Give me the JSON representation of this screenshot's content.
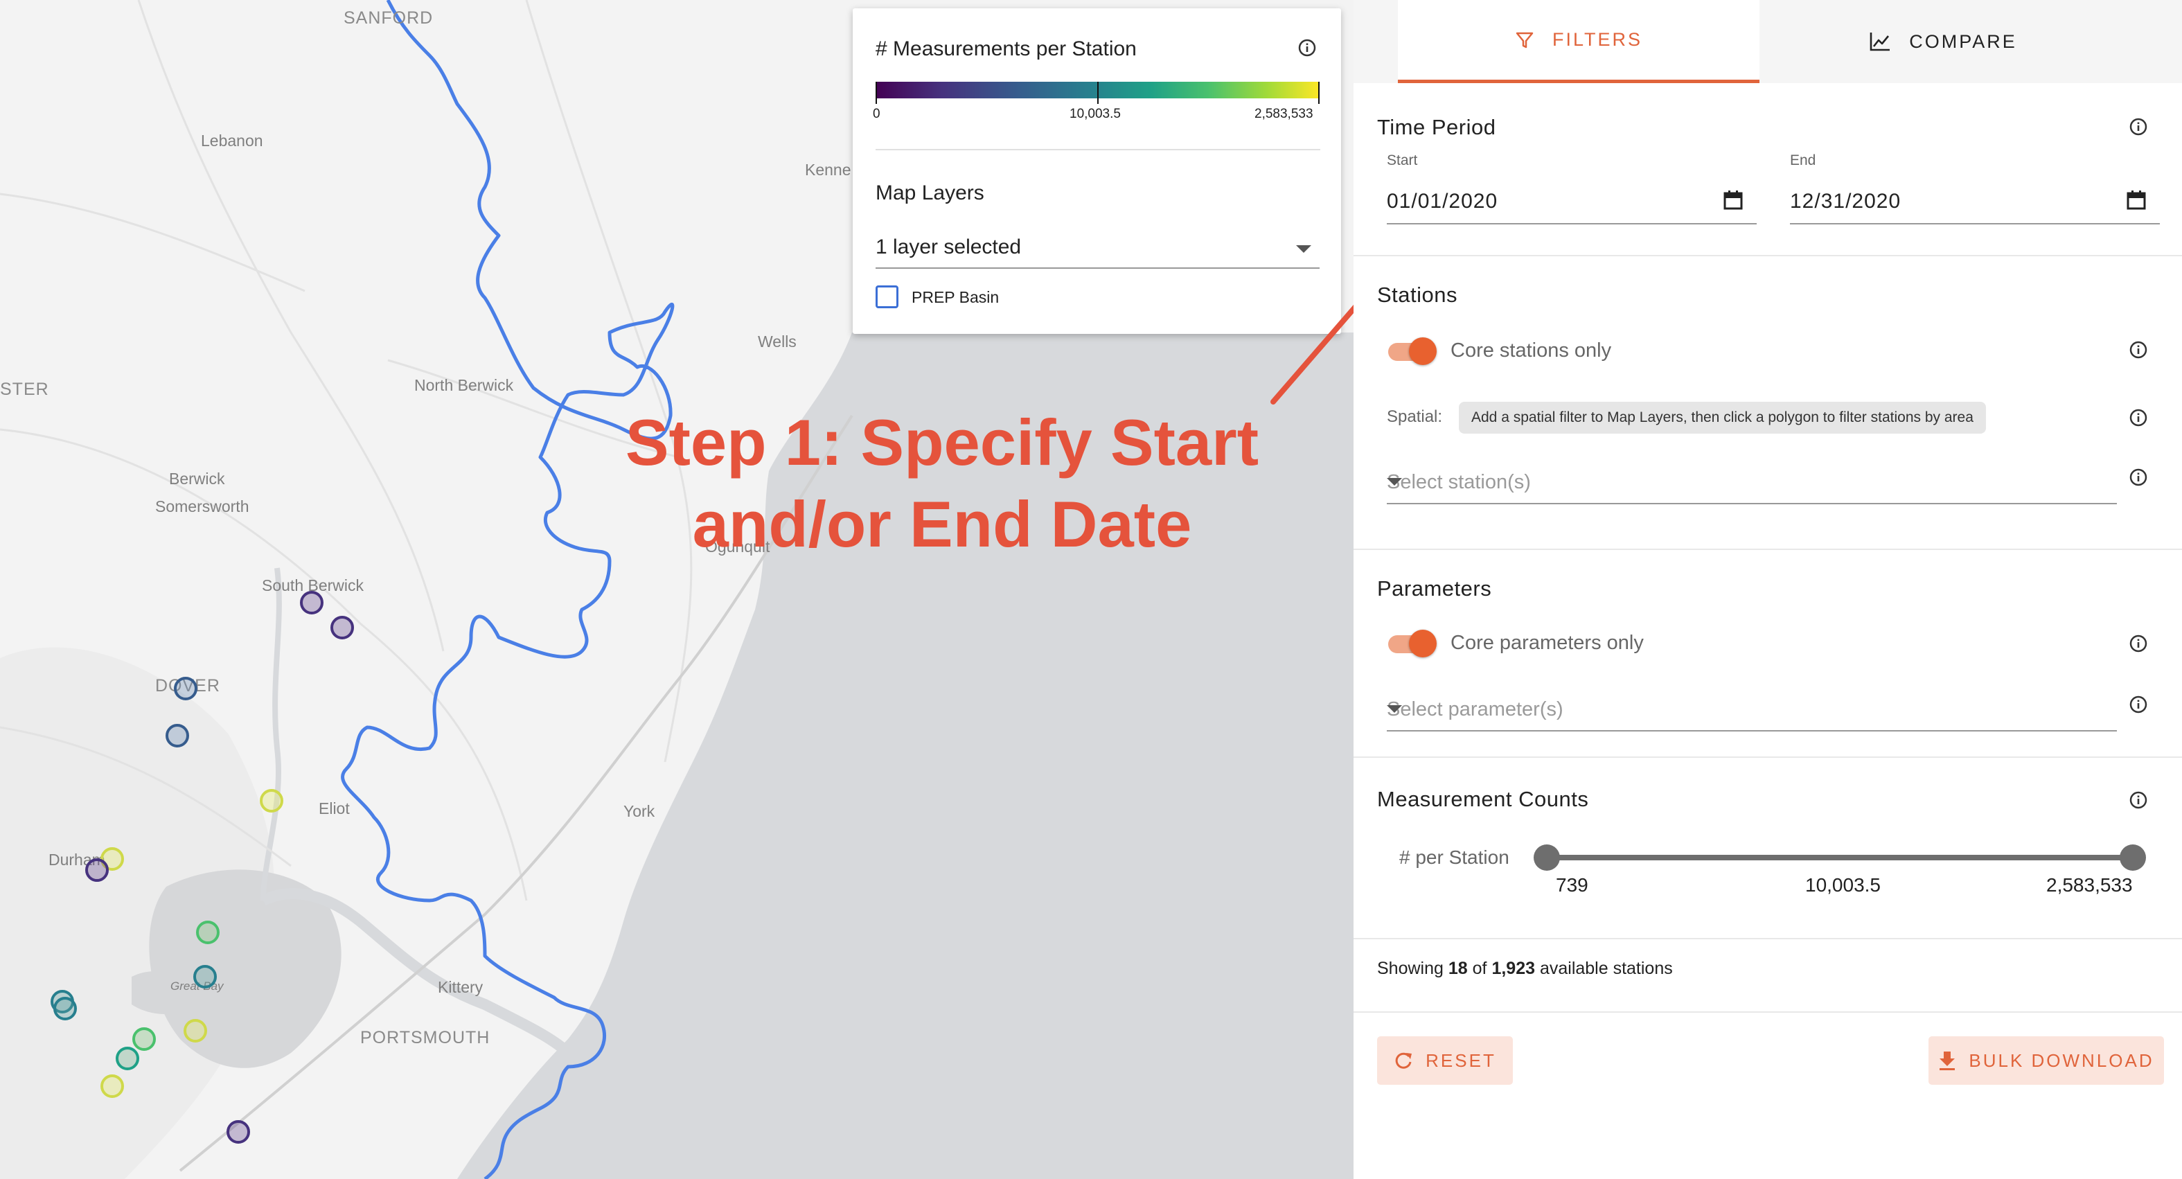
{
  "map": {
    "places": {
      "sanford": "SANFORD",
      "lebanon": "Lebanon",
      "kenne": "Kenne",
      "wells": "Wells",
      "north_berwick": "North Berwick",
      "ster": "STER",
      "berwick": "Berwick",
      "somersworth": "Somersworth",
      "south_berwick": "South Berwick",
      "dover": "DOVER",
      "ogunquit": "Ogunquit",
      "eliot": "Eliot",
      "york": "York",
      "durham": "Durham",
      "great_bay": "Great Bay",
      "kittery": "Kittery",
      "portsmouth": "PORTSMOUTH"
    }
  },
  "legend": {
    "title": "# Measurements per Station",
    "colorbar": {
      "min": "0",
      "mid": "10,003.5",
      "max": "2,583,533",
      "colors": [
        "#440154",
        "#46327e",
        "#365c8d",
        "#277f8e",
        "#1fa187",
        "#4ac16d",
        "#a0da39",
        "#fde725"
      ]
    },
    "map_layers_label": "Map Layers",
    "layer_select_value": "1 layer selected",
    "prep_basin_label": "PREP Basin",
    "prep_basin_checked": false
  },
  "annotation": {
    "line1": "Step 1: Specify Start",
    "line2": "and/or End Date",
    "color": "#e5533c"
  },
  "panel": {
    "tabs": [
      {
        "label": "FILTERS",
        "icon": "filter-icon",
        "active": true
      },
      {
        "label": "COMPARE",
        "icon": "chart-line-icon",
        "active": false
      }
    ],
    "time_period": {
      "title": "Time Period",
      "start_label": "Start",
      "start_value": "01/01/2020",
      "end_label": "End",
      "end_value": "12/31/2020"
    },
    "stations": {
      "title": "Stations",
      "core_toggle_label": "Core stations only",
      "core_toggle_on": true,
      "spatial_label": "Spatial:",
      "spatial_hint": "Add a spatial filter to Map Layers, then click a polygon to filter stations by area",
      "select_placeholder": "Select station(s)"
    },
    "parameters": {
      "title": "Parameters",
      "core_toggle_label": "Core parameters only",
      "core_toggle_on": true,
      "select_placeholder": "Select parameter(s)"
    },
    "measurement_counts": {
      "title": "Measurement Counts",
      "slider_label": "# per Station",
      "min": "739",
      "mid": "10,003.5",
      "max": "2,583,533"
    },
    "showing": {
      "prefix": "Showing",
      "count": "18",
      "of": "of",
      "total": "1,923",
      "suffix": "available stations"
    },
    "buttons": {
      "reset": "RESET",
      "bulk_download": "BULK DOWNLOAD"
    },
    "accent": "#e0643b"
  }
}
